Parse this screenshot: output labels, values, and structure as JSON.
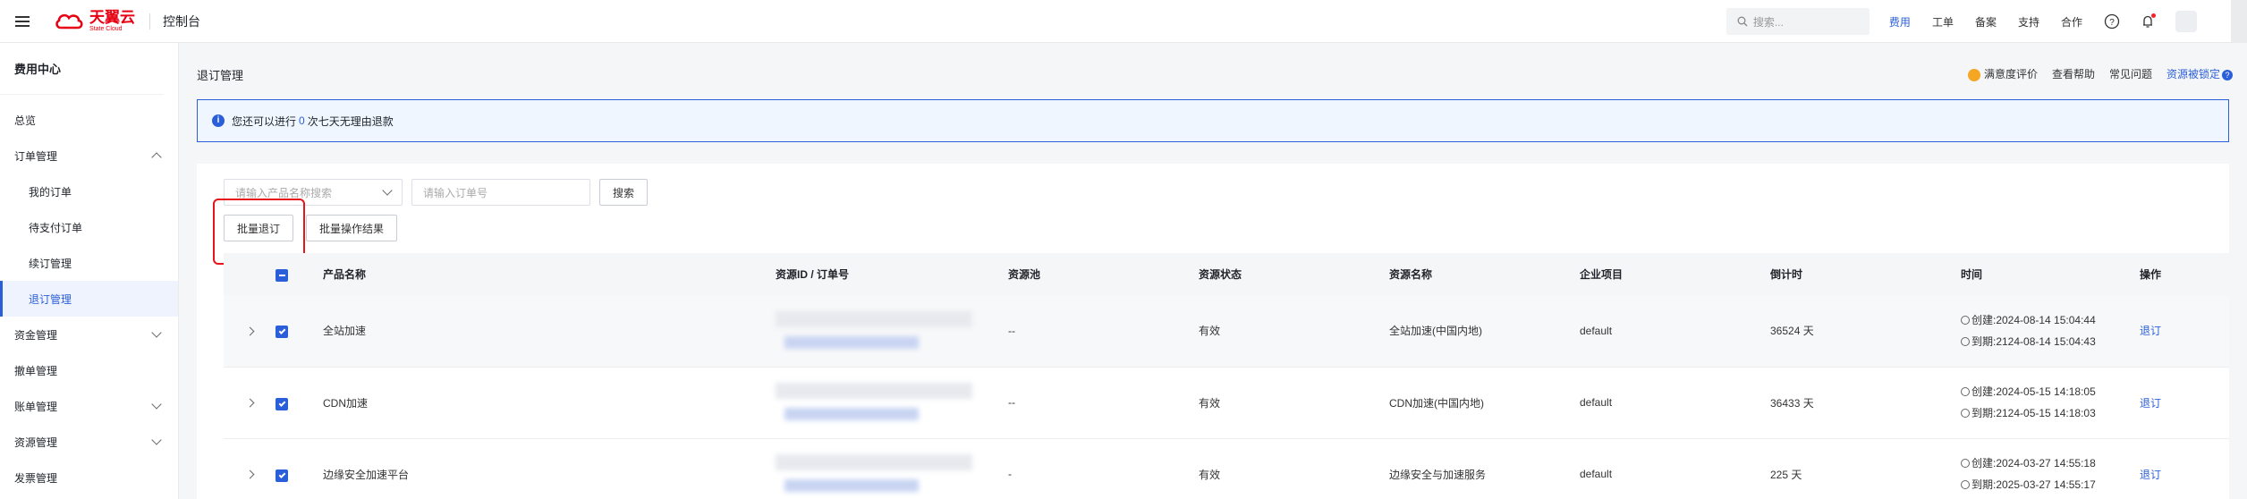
{
  "topbar": {
    "logo_cn": "天翼云",
    "logo_en": "State Cloud",
    "console": "控制台",
    "search_placeholder": "搜索...",
    "links": [
      "费用",
      "工单",
      "备案",
      "支持",
      "合作"
    ]
  },
  "sidebar": {
    "title": "费用中心",
    "items": [
      {
        "label": "总览",
        "level": 0
      },
      {
        "label": "订单管理",
        "level": 0,
        "expanded": true
      },
      {
        "label": "我的订单",
        "level": 1
      },
      {
        "label": "待支付订单",
        "level": 1
      },
      {
        "label": "续订管理",
        "level": 1
      },
      {
        "label": "退订管理",
        "level": 1,
        "active": true
      },
      {
        "label": "资金管理",
        "level": 0,
        "expanded": false
      },
      {
        "label": "撤单管理",
        "level": 0
      },
      {
        "label": "账单管理",
        "level": 0,
        "expanded": false
      },
      {
        "label": "资源管理",
        "level": 0,
        "expanded": false
      },
      {
        "label": "发票管理",
        "level": 0
      }
    ]
  },
  "page": {
    "title": "退订管理",
    "head_links": {
      "satisfaction": "满意度评价",
      "help": "查看帮助",
      "faq": "常见问题",
      "locked": "资源被锁定"
    }
  },
  "notice": {
    "prefix": "您还可以进行",
    "count": "0",
    "suffix": "次七天无理由退款"
  },
  "filter": {
    "product_placeholder": "请输入产品名称搜索",
    "order_placeholder": "请输入订单号",
    "search_button": "搜索",
    "batch_unsubscribe": "批量退订",
    "batch_results": "批量操作结果"
  },
  "table": {
    "headers": [
      "产品名称",
      "资源ID / 订单号",
      "资源池",
      "资源状态",
      "资源名称",
      "企业项目",
      "倒计时",
      "时间",
      "操作"
    ],
    "rows": [
      {
        "product": "全站加速",
        "pool": "--",
        "status": "有效",
        "resource_name": "全站加速(中国内地)",
        "project": "default",
        "countdown": "36524 天",
        "created": "创建:2024-08-14 15:04:44",
        "expires": "到期:2124-08-14 15:04:43",
        "action": "退订"
      },
      {
        "product": "CDN加速",
        "pool": "--",
        "status": "有效",
        "resource_name": "CDN加速(中国内地)",
        "project": "default",
        "countdown": "36433 天",
        "created": "创建:2024-05-15 14:18:05",
        "expires": "到期:2124-05-15 14:18:03",
        "action": "退订"
      },
      {
        "product": "边缘安全加速平台",
        "pool": "-",
        "status": "有效",
        "resource_name": "边缘安全与加速服务",
        "project": "default",
        "countdown": "225 天",
        "created": "创建:2024-03-27 14:55:18",
        "expires": "到期:2025-03-27 14:55:17",
        "action": "退订"
      }
    ]
  },
  "colors": {
    "accent": "#2b5fd9",
    "brand": "#e60012",
    "highlight_box": "#e8141c"
  }
}
